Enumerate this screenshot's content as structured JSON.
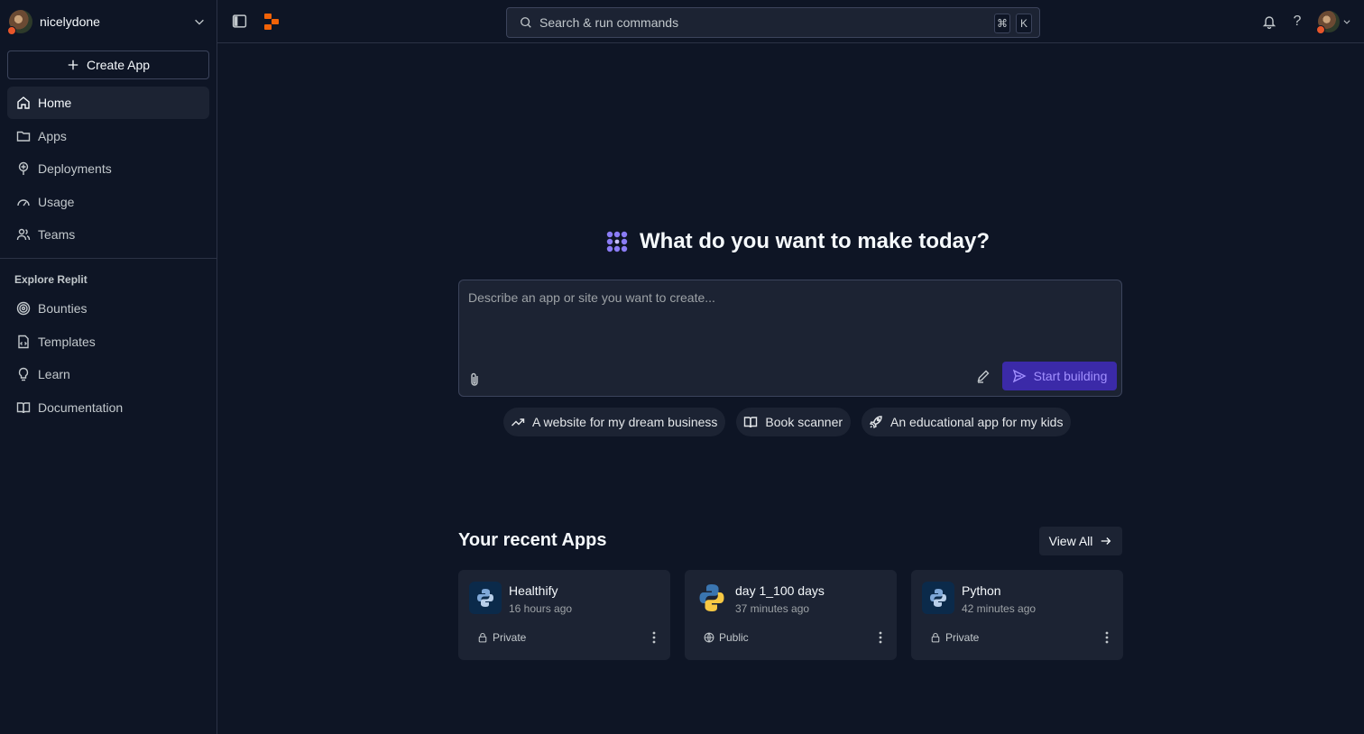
{
  "sidebar": {
    "username": "nicelydone",
    "create_label": "Create App",
    "nav": [
      {
        "label": "Home",
        "icon": "home-icon",
        "active": true
      },
      {
        "label": "Apps",
        "icon": "folder-icon"
      },
      {
        "label": "Deployments",
        "icon": "deployments-icon"
      },
      {
        "label": "Usage",
        "icon": "gauge-icon"
      },
      {
        "label": "Teams",
        "icon": "users-icon"
      }
    ],
    "explore_label": "Explore Replit",
    "explore": [
      {
        "label": "Bounties",
        "icon": "target-icon"
      },
      {
        "label": "Templates",
        "icon": "template-icon"
      },
      {
        "label": "Learn",
        "icon": "lightbulb-icon"
      },
      {
        "label": "Documentation",
        "icon": "book-icon"
      }
    ]
  },
  "topbar": {
    "search_placeholder": "Search & run commands",
    "kbd_cmd": "⌘",
    "kbd_k": "K",
    "help": "?"
  },
  "hero": {
    "title": "What do you want to make today?",
    "prompt_placeholder": "Describe an app or site you want to create...",
    "start_label": "Start building"
  },
  "chips": [
    {
      "label": "A website for my dream business",
      "icon": "trending-up-icon"
    },
    {
      "label": "Book scanner",
      "icon": "book-open-icon"
    },
    {
      "label": "An educational app for my kids",
      "icon": "rocket-icon"
    }
  ],
  "recent": {
    "title": "Your recent Apps",
    "view_all": "View All",
    "apps": [
      {
        "name": "Healthify",
        "time": "16 hours ago",
        "visibility": "Private"
      },
      {
        "name": "day 1_100 days",
        "time": "37 minutes ago",
        "visibility": "Public"
      },
      {
        "name": "Python",
        "time": "42 minutes ago",
        "visibility": "Private"
      }
    ]
  },
  "colors": {
    "background": "#0e1525",
    "surface": "#1c2333",
    "accent": "#3b2aa8",
    "accent_text": "#a290ff",
    "logo_orange": "#f26207"
  }
}
